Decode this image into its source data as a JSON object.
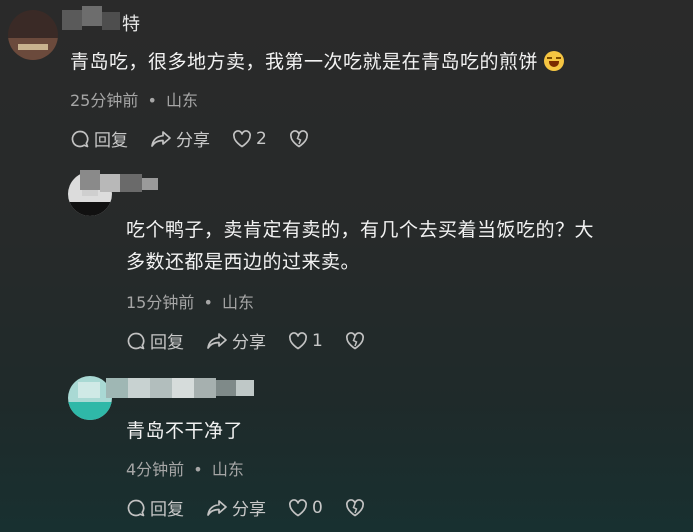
{
  "comments": [
    {
      "username": "特",
      "text": "青岛吃，很多地方卖，我第一次吃就是在青岛吃的煎饼",
      "emoji": "😂",
      "time": "25分钟前",
      "location": "山东",
      "reply_label": "回复",
      "share_label": "分享",
      "likes": "2"
    },
    {
      "text_line1": "吃个鸭子，卖肯定有卖的，有几个去买着当饭吃的？大",
      "text_line2": "多数还都是西边的过来卖。",
      "time": "15分钟前",
      "location": "山东",
      "reply_label": "回复",
      "share_label": "分享",
      "likes": "1"
    },
    {
      "text": "青岛不干净了",
      "time": "4分钟前",
      "location": "山东",
      "reply_label": "回复",
      "share_label": "分享",
      "likes": "0"
    }
  ],
  "meta_separator": "•",
  "colors": {
    "text_primary": "#f2f2f2",
    "text_meta": "#a6a6a6",
    "icon": "#c2c2c2"
  }
}
